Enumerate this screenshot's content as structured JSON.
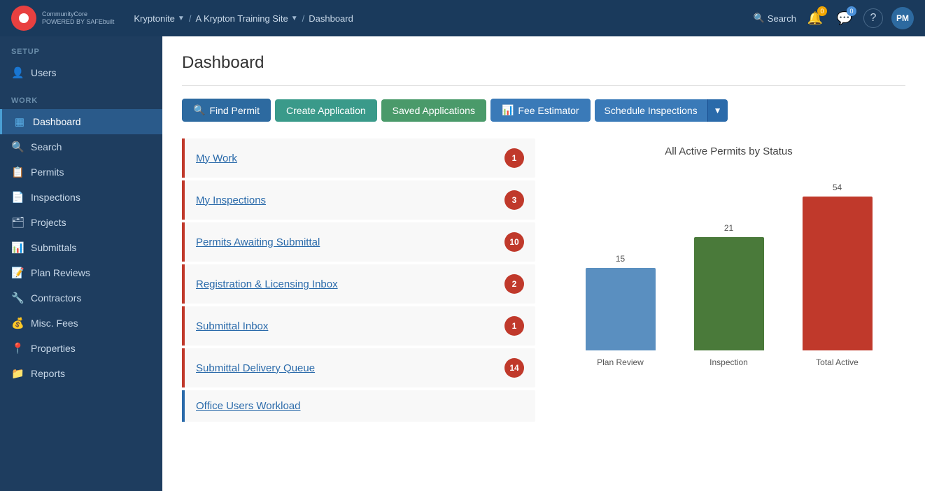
{
  "app": {
    "name": "CommunityCore",
    "tagline": "POWERED BY SAFEbuilt"
  },
  "breadcrumb": {
    "org": "Kryptonite",
    "site": "A Krypton Training Site",
    "page": "Dashboard"
  },
  "nav": {
    "search_label": "Search",
    "help_label": "?",
    "avatar_label": "PM",
    "bell_badge": "0",
    "chat_badge": "0"
  },
  "sidebar": {
    "setup_label": "SETUP",
    "work_label": "WORK",
    "items_setup": [
      {
        "label": "Users",
        "icon": "👤",
        "id": "users"
      }
    ],
    "items_work": [
      {
        "label": "Dashboard",
        "icon": "▦",
        "id": "dashboard",
        "active": true
      },
      {
        "label": "Search",
        "icon": "🔍",
        "id": "search"
      },
      {
        "label": "Permits",
        "icon": "📋",
        "id": "permits"
      },
      {
        "label": "Inspections",
        "icon": "📄",
        "id": "inspections"
      },
      {
        "label": "Projects",
        "icon": "🗂",
        "id": "projects"
      },
      {
        "label": "Submittals",
        "icon": "📊",
        "id": "submittals"
      },
      {
        "label": "Plan Reviews",
        "icon": "📝",
        "id": "plan-reviews"
      },
      {
        "label": "Contractors",
        "icon": "🔧",
        "id": "contractors"
      },
      {
        "label": "Misc. Fees",
        "icon": "💰",
        "id": "misc-fees"
      },
      {
        "label": "Properties",
        "icon": "📍",
        "id": "properties"
      },
      {
        "label": "Reports",
        "icon": "📁",
        "id": "reports"
      }
    ]
  },
  "page": {
    "title": "Dashboard"
  },
  "toolbar": {
    "find_permit": "Find Permit",
    "create_application": "Create Application",
    "saved_applications": "Saved Applications",
    "fee_estimator": "Fee Estimator",
    "schedule_inspections": "Schedule Inspections"
  },
  "work_items": [
    {
      "label": "My Work",
      "badge": "1",
      "border": "red"
    },
    {
      "label": "My Inspections",
      "badge": "3",
      "border": "red"
    },
    {
      "label": "Permits Awaiting Submittal",
      "badge": "10",
      "border": "red"
    },
    {
      "label": "Registration & Licensing Inbox",
      "badge": "2",
      "border": "red"
    },
    {
      "label": "Submittal Inbox",
      "badge": "1",
      "border": "red"
    },
    {
      "label": "Submittal Delivery Queue",
      "badge": "14",
      "border": "red"
    },
    {
      "label": "Office Users Workload",
      "badge": null,
      "border": "blue"
    }
  ],
  "chart": {
    "title": "All Active Permits by Status",
    "bars": [
      {
        "label": "Plan Review",
        "value": 15,
        "color": "blue",
        "height_pct": 42
      },
      {
        "label": "Inspection",
        "value": 21,
        "color": "green",
        "height_pct": 58
      },
      {
        "label": "Total Active",
        "value": 54,
        "color": "red",
        "height_pct": 100
      }
    ]
  }
}
